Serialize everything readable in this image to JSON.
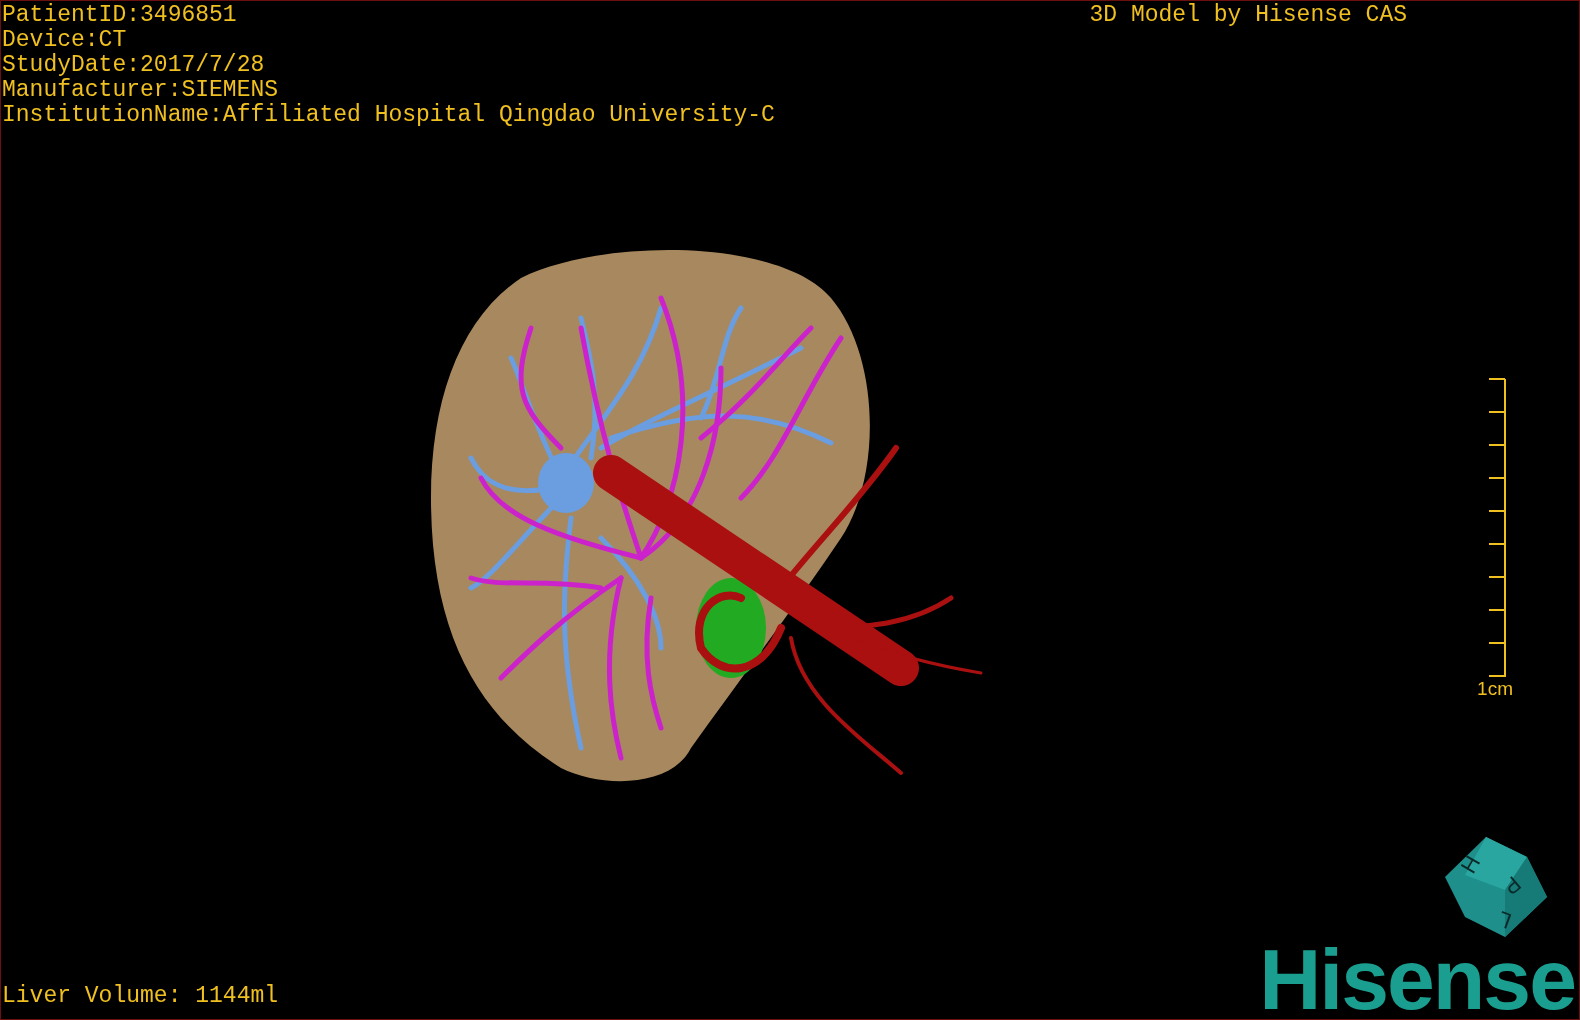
{
  "info_lines": [
    "PatientID:3496851",
    "Device:CT",
    "StudyDate:2017/7/28",
    "Manufacturer:SIEMENS",
    "InstitutionName:Affiliated Hospital Qingdao University-C"
  ],
  "title": "3D Model by Hisense CAS",
  "scale_bar": {
    "label": "1cm"
  },
  "orientation_cube": {
    "labels": [
      "H",
      "P",
      "L"
    ]
  },
  "liver_volume": "Liver Volume: 1144ml",
  "logo": "Hisense"
}
